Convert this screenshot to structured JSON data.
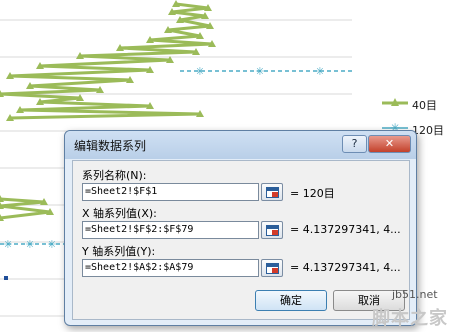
{
  "chart": {
    "legend": [
      {
        "label": "40目",
        "color": "#9bbb59",
        "marker": "triangle"
      },
      {
        "label": "120目",
        "color": "#4bacc6",
        "marker": "star"
      }
    ]
  },
  "dialog": {
    "title": "编辑数据系列",
    "help_label": "?",
    "close_label": "✕",
    "series_name": {
      "label": "系列名称(N):",
      "value": "=Sheet2!$F$1",
      "preview": "= 120目"
    },
    "x_values": {
      "label": "X 轴系列值(X):",
      "value": "=Sheet2!$F$2:$F$79",
      "preview": "= 4.137297341, 4..."
    },
    "y_values": {
      "label": "Y 轴系列值(Y):",
      "value": "=Sheet2!$A$2:$A$79",
      "preview": "= 4.137297341, 4..."
    },
    "ok_label": "确定",
    "cancel_label": "取消"
  },
  "watermark": {
    "url": "jb51.net",
    "site": "脚本之家"
  },
  "colors": {
    "series_40": "#9bbb59",
    "series_120": "#4bacc6",
    "dialog_bg": "#e3edf8"
  }
}
